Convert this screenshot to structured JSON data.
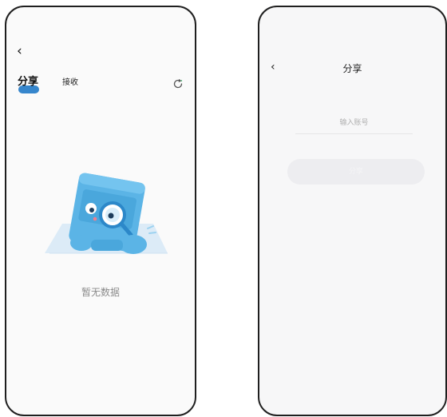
{
  "left_screen": {
    "back_glyph": "‹",
    "tabs": [
      {
        "label": "分享",
        "active": true
      },
      {
        "label": "接收",
        "active": false
      }
    ],
    "refresh_icon": "refresh-icon",
    "empty_state": {
      "illustration": "magnifier-box-illustration",
      "message": "暂无数据"
    }
  },
  "right_screen": {
    "back_glyph": "‹",
    "title": "分享",
    "account_input": {
      "value": "",
      "placeholder": "输入账号"
    },
    "share_button": {
      "label": "分享",
      "enabled": false
    }
  },
  "colors": {
    "accent": "#2b7fc9",
    "illustration_blue": "#5bb4e6",
    "disabled_button_bg": "#ededf0",
    "placeholder_text": "#b0b0b0",
    "empty_text": "#8a8a8a"
  }
}
